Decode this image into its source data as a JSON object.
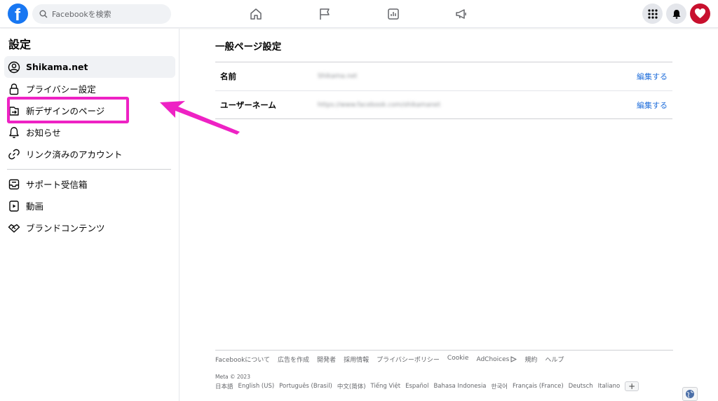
{
  "topbar": {
    "search_placeholder": "Facebookを検索",
    "nav_icons": [
      "home-icon",
      "flag-icon",
      "chart-icon",
      "megaphone-icon"
    ],
    "right_icons": [
      "grid-menu-icon",
      "bell-icon",
      "profile-avatar"
    ],
    "brand_color": "#1877f2"
  },
  "sidebar": {
    "title": "設定",
    "items": [
      {
        "label": "Shikama.net",
        "icon": "user-circle-icon"
      },
      {
        "label": "プライバシー設定",
        "icon": "lock-icon"
      },
      {
        "label": "新デザインのページ",
        "icon": "new-page-icon"
      },
      {
        "label": "お知らせ",
        "icon": "bell-icon"
      },
      {
        "label": "リンク済みのアカウント",
        "icon": "link-icon"
      },
      {
        "label": "サポート受信箱",
        "icon": "inbox-icon"
      },
      {
        "label": "動画",
        "icon": "video-icon"
      },
      {
        "label": "ブランドコンテンツ",
        "icon": "handshake-icon"
      }
    ]
  },
  "annotation": {
    "color": "#ee22c4"
  },
  "main": {
    "title": "一般ページ設定",
    "rows": [
      {
        "key": "名前",
        "value": "Shikama.net",
        "edit": "編集する"
      },
      {
        "key": "ユーザーネーム",
        "value": "https://www.facebook.com/shikamanet",
        "edit": "編集する"
      }
    ]
  },
  "footer": {
    "links": [
      "Facebookについて",
      "広告を作成",
      "開発者",
      "採用情報",
      "プライバシーポリシー",
      "Cookie",
      "AdChoices",
      "規約",
      "ヘルプ"
    ],
    "copyright": "Meta © 2023",
    "languages": [
      "日本語",
      "English (US)",
      "Português (Brasil)",
      "中文(简体)",
      "Tiếng Việt",
      "Español",
      "Bahasa Indonesia",
      "한국어",
      "Français (France)",
      "Deutsch",
      "Italiano"
    ],
    "more_languages": "+"
  }
}
